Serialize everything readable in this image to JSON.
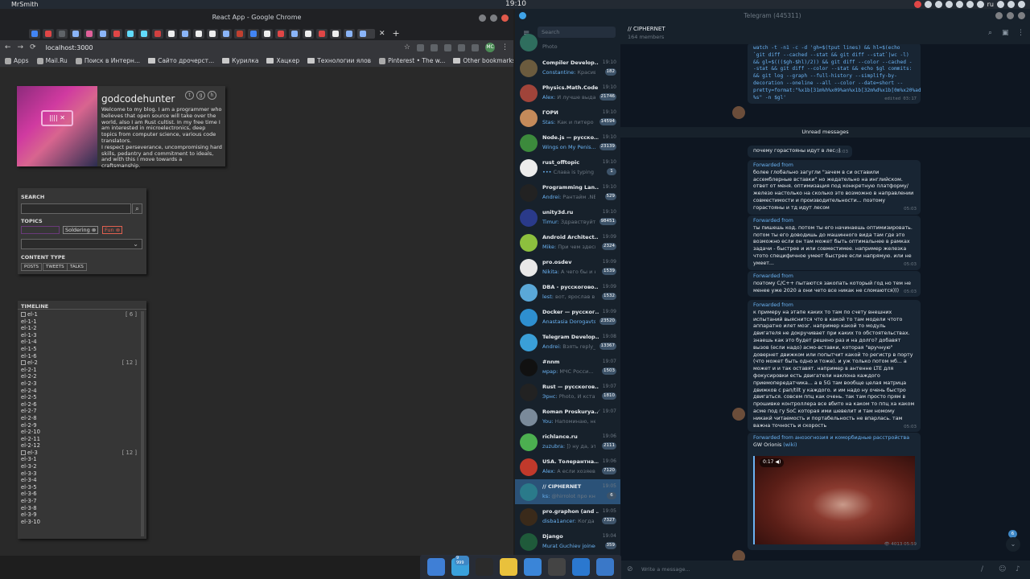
{
  "topbar": {
    "user": "MrSmith",
    "clock": "19:10",
    "lang": "ru"
  },
  "chrome": {
    "title": "React App - Google Chrome",
    "url": "localhost:3000",
    "profile": "MC",
    "bookmarks": [
      {
        "label": "Apps",
        "kind": "apps"
      },
      {
        "label": "Mail.Ru",
        "kind": "site"
      },
      {
        "label": "Поиск в Интерн...",
        "kind": "site"
      },
      {
        "label": "Сайто дрочерст...",
        "kind": "folder"
      },
      {
        "label": "Курилка",
        "kind": "folder"
      },
      {
        "label": "Хацкер",
        "kind": "folder"
      },
      {
        "label": "Технологии ялов",
        "kind": "folder"
      },
      {
        "label": "Pinterest • The w...",
        "kind": "site"
      }
    ],
    "other_bookmarks": "Other bookmarks"
  },
  "profile": {
    "name": "godcodehunter",
    "bio": "Welcome to my blog. I am a programmer who believes that open source will take over the world, also I am Rust cultist. In my free time I am interested in microelectronics, deep topics from computer science, various code translators.\nI respect perseverance, uncompromising hard skills, pedantry and commitment to ideals, and with this I move towards a craftsmanship."
  },
  "filters": {
    "search_label": "SEARCH",
    "topics_label": "TOPICS",
    "topics": [
      "Soldering",
      "Fun"
    ],
    "content_type_label": "CONTENT TYPE",
    "content_types": [
      "POSTS",
      "TWEETS",
      "TALKS"
    ]
  },
  "timeline": {
    "title": "TIMELINE",
    "items": [
      {
        "label": "el-1",
        "group": true,
        "count": "[ 6 ]"
      },
      {
        "label": "el-1-1"
      },
      {
        "label": "el-1-2"
      },
      {
        "label": "el-1-3"
      },
      {
        "label": "el-1-4"
      },
      {
        "label": "el-1-5"
      },
      {
        "label": "el-1-6"
      },
      {
        "label": "el-2",
        "group": true,
        "count": "[ 12 ]"
      },
      {
        "label": "el-2-1"
      },
      {
        "label": "el-2-2"
      },
      {
        "label": "el-2-3"
      },
      {
        "label": "el-2-4"
      },
      {
        "label": "el-2-5"
      },
      {
        "label": "el-2-6"
      },
      {
        "label": "el-2-7"
      },
      {
        "label": "el-2-8"
      },
      {
        "label": "el-2-9"
      },
      {
        "label": "el-2-10"
      },
      {
        "label": "el-2-11"
      },
      {
        "label": "el-2-12"
      },
      {
        "label": "el-3",
        "group": true,
        "count": "[ 12 ]"
      },
      {
        "label": "el-3-1"
      },
      {
        "label": "el-3-2"
      },
      {
        "label": "el-3-3"
      },
      {
        "label": "el-3-4"
      },
      {
        "label": "el-3-5"
      },
      {
        "label": "el-3-6"
      },
      {
        "label": "el-3-7"
      },
      {
        "label": "el-3-8"
      },
      {
        "label": "el-3-9"
      },
      {
        "label": "el-3-10"
      }
    ]
  },
  "telegram": {
    "title": "Telegram (445311)",
    "search_placeholder": "Search",
    "chat_title": "// CIPHERNET",
    "members": "164 members",
    "chats": [
      {
        "name": "",
        "time": "",
        "preview": "Photo",
        "badge": "",
        "color": "#2f6e5e"
      },
      {
        "name": "Compiler Develop...",
        "time": "19:10",
        "who": "Constantine:",
        "preview": "Красиво",
        "badge": "182",
        "color": "#6b5b3e"
      },
      {
        "name": "Physics.Math.Code",
        "time": "19:10",
        "who": "Alex:",
        "preview": "И лучше выда...",
        "badge": "21746",
        "color": "#a0443a"
      },
      {
        "name": "ГОРИ",
        "time": "19:10",
        "who": "Stas:",
        "preview": "Как и питеро и...",
        "badge": "14594",
        "color": "#c48a5a"
      },
      {
        "name": "Node.js — русско...",
        "time": "19:10",
        "who": "Wings on My Penis...",
        "preview": "",
        "badge": "23139",
        "color": "#3c8a3c"
      },
      {
        "name": "rust_offtopic",
        "time": "19:10",
        "who": "•••",
        "preview": "Слава is typing",
        "badge": "1",
        "color": "#ececec"
      },
      {
        "name": "Programming Lan...",
        "time": "19:10",
        "who": "Andrei:",
        "preview": "Рантайм .NET ...",
        "badge": "529",
        "color": "#222222"
      },
      {
        "name": "unity3d.ru",
        "time": "19:10",
        "who": "Timur:",
        "preview": "Здравствуйт...",
        "badge": "98451",
        "color": "#2a3a8a"
      },
      {
        "name": "Android Architect...",
        "time": "19:09",
        "who": "Mike:",
        "preview": "При чем здесь ...",
        "badge": "2324",
        "color": "#8cbf3e"
      },
      {
        "name": "pro.osdev",
        "time": "19:09",
        "who": "Nikita:",
        "preview": "А чего бы и не...",
        "badge": "1539",
        "color": "#e8e8e8"
      },
      {
        "name": "DBA - русскогово...",
        "time": "19:09",
        "who": "lest:",
        "preview": "вот, ярослав в п...",
        "badge": "1532",
        "color": "#5aa8d8"
      },
      {
        "name": "Docker — русског...",
        "time": "19:09",
        "who": "Anastasia Dorogavts...",
        "preview": "",
        "badge": "23520",
        "color": "#2e8fd0"
      },
      {
        "name": "Telegram Develop...",
        "time": "19:08",
        "who": "Andrei:",
        "preview": "Взять reply_t...",
        "badge": "13367",
        "color": "#3a9fd8"
      },
      {
        "name": "#nnm",
        "time": "19:07",
        "who": "мрар:",
        "preview": "МЧС Росси...",
        "badge": "1503",
        "color": "#111111"
      },
      {
        "name": "Rust — русскогов...",
        "time": "19:07",
        "who": "Эрнс:",
        "preview": "Photo, И кстат...",
        "badge": "1810",
        "color": "#222222"
      },
      {
        "name": "Roman Proskurya...",
        "time": "✓ 19:07",
        "who": "You:",
        "preview": "Напоминаю, не знаю д...",
        "badge": "",
        "color": "#7a8a9a"
      },
      {
        "name": "richlance.ru",
        "time": "19:06",
        "who": "zuzubra:",
        "preview": "]) ну да, эта ...",
        "badge": "2111",
        "color": "#4caf50"
      },
      {
        "name": "USA. Толерантна...",
        "time": "19:06",
        "who": "Alex:",
        "preview": "А если хозяева ...",
        "badge": "7120",
        "color": "#c0392b"
      },
      {
        "name": "// CIPHERNET",
        "time": "19:05",
        "who": "ks:",
        "preview": "@hirrolot про книги ...",
        "badge": "6",
        "color": "#2a7a8a",
        "active": true
      },
      {
        "name": "pro.graphon (and ...",
        "time": "19:05",
        "who": "disba1ancer:",
        "preview": "Когда к...",
        "badge": "7327",
        "color": "#3a2a1a"
      },
      {
        "name": "Django",
        "time": "19:04",
        "who": "Murat Guchiev joined t...",
        "preview": "",
        "badge": "359",
        "color": "#1f5a3a"
      }
    ],
    "messages": {
      "code": "watch -t -n1 -c -d 'gh=$(tput lines) && hl=$(echo `git diff --cached --stat && git diff --stat`|wc -l) && gl=$((($gh-$hl)/2)) && git diff --color --cached --stat && git diff --color --stat && echo $gl commits: && git log --graph --full-history --simplify-by-decoration --oneline --all --color --date=short --pretty=format:\"%x1b[31m%h%x09%an%x1b[32m%d%x1b[0m%x20%ad %s\" -n $gl'",
      "code_time": "edited 03:17",
      "unread": "Unread messages",
      "m1": "почему горастояны идут в лес :)",
      "m1_time": "05:03",
      "fwd_label": "Forwarded from",
      "m2": "более глобально загугли \"зачем в си оставили ассемблерные вставки\" но жедательно на инглийском. ответ от меня. оптимизация под конкретную платформу/железо настолько на сколько это возможно в направлении совместимости и производительности... поэтому горастояны и тд идут лесом",
      "m2_time": "05:03",
      "m3": "ты пишешь код. потом ты его начинаешь оптимизировать. потом ты его доводишь до машинного вида там где это возможно если он там может быть оптимальнее в рамках задачи - быстрее и или совместимее. например железка чтото специфичное умеет быстрее если напрямую. или не умеет...",
      "m3_time": "05:03",
      "m4": "поэтому C/C++ пытаются закопать который год но тем не менее уже 2020 а они чето все никак не сломаются)))",
      "m4_time": "05:03",
      "m5": "к примеру на этапе каких то там по счету внешних испытаний выяснится что в какой то там модели чтото аппаратно илет мозг. например какой то модуль двигателя не докручивает при каких то обстоятельствах. знаешь как это будет решено раз и на долго? добавят вызов (если надо) асмо-вставки, которая \"вручную\" довернет движком или попытчит какой то регистр в порту (что может быть одно и тоже). и уж только потом мб... а может и и так оставят. например в антенне LTE для фокусировки есть двигатели наклона каждого приемопередатчика... а в 5G там вообще целая матрица движков с рап/tilt у каждого. и им надо ну очень быстро двигаться. совсем ппц как очень. так там просто прям в прошивке контроллера все вбито на каком то ппц ха каком асме под гу SoC которая ими шевелит и там номому никакй читаемость и портабельность не впарлась. там важна точность и скорость",
      "m5_time": "05:03",
      "m6_fwd": "Forwarded from анозогнозия и коморбидные расстройства",
      "m6_from": "GW Orionis",
      "m6_from_link": "(wiki)",
      "m6_dur": "0:17",
      "m6_views": "4013",
      "m6_time": "05:59",
      "scroll_badge": "6"
    },
    "input_placeholder": "Write a message..."
  },
  "dock": {
    "badge": "9 999"
  }
}
